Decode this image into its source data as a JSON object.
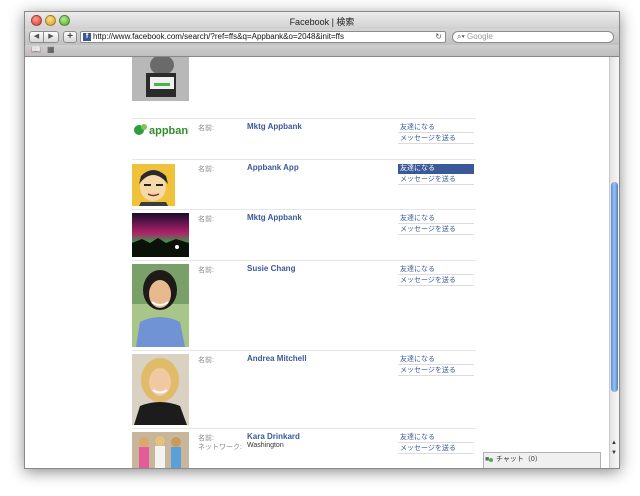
{
  "window": {
    "title": "Facebook | 検索"
  },
  "toolbar": {
    "back": "◀",
    "forward": "▶",
    "add": "+",
    "url": "http://www.facebook.com/search/?ref=ffs&q=Appbank&o=2048&init=ffs",
    "reload": "↻",
    "search_placeholder": "Google"
  },
  "results": [
    {
      "label": "名前:",
      "name": "Mktg Appbank",
      "network_label": "",
      "network": "",
      "add_friend": "友達になる",
      "message": "メッセージを送る",
      "highlight": false,
      "photo": "appbank-logo",
      "logo_text": "appbank"
    },
    {
      "label": "名前:",
      "name": "Appbank App",
      "network_label": "",
      "network": "",
      "add_friend": "友達になる",
      "message": "メッセージを送る",
      "highlight": true,
      "photo": "cartoon-avatar"
    },
    {
      "label": "名前:",
      "name": "Mktg Appbank",
      "network_label": "",
      "network": "",
      "add_friend": "友達になる",
      "message": "メッセージを送る",
      "highlight": false,
      "photo": "aurora-photo"
    },
    {
      "label": "名前:",
      "name": "Susie Chang",
      "network_label": "",
      "network": "",
      "add_friend": "友達になる",
      "message": "メッセージを送る",
      "highlight": false,
      "photo": "portrait-woman"
    },
    {
      "label": "名前:",
      "name": "Andrea Mitchell",
      "network_label": "",
      "network": "",
      "add_friend": "友達になる",
      "message": "メッセージを送る",
      "highlight": false,
      "photo": "portrait-blonde"
    },
    {
      "label": "名前:",
      "name": "Kara Drinkard",
      "network_label": "ネットワーク:",
      "network": "Washington",
      "add_friend": "友達になる",
      "message": "メッセージを送る",
      "highlight": false,
      "photo": "group-photo"
    }
  ],
  "chat": {
    "label": "チャット（0）"
  }
}
